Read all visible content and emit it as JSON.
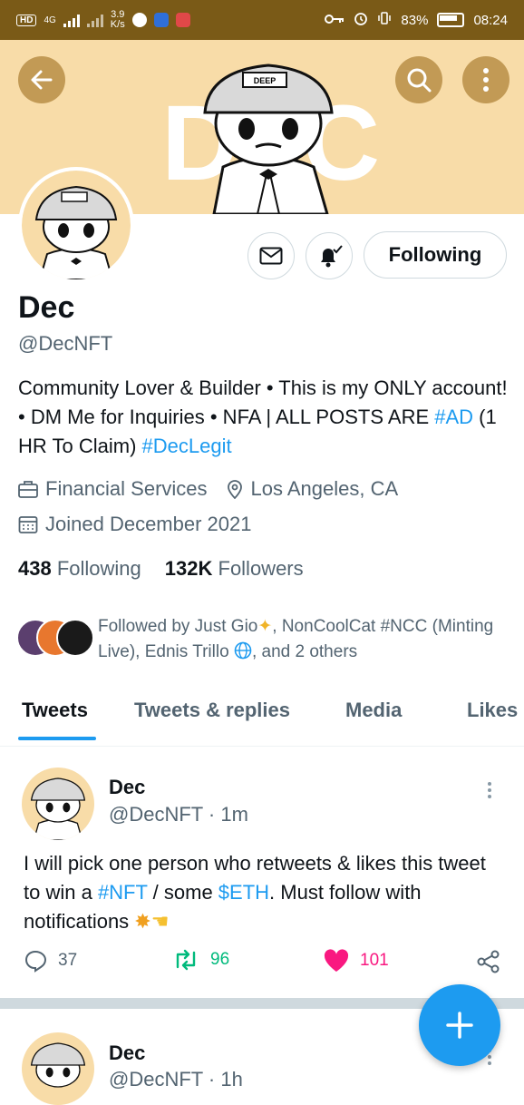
{
  "status_bar": {
    "hd": "HD",
    "network": "4G",
    "speed_value": "3.9",
    "speed_unit": "K/s",
    "battery": "83%",
    "time": "08:24"
  },
  "banner": {
    "text": "DEC",
    "cap_text": "DEEP",
    "color": "#f8dca8"
  },
  "profile": {
    "name": "Dec",
    "handle": "@DecNFT",
    "follow_button": "Following",
    "bio_parts": {
      "p1": "Community Lover & Builder • This is my ONLY account! • DM Me for Inquiries • NFA | ALL POSTS ARE ",
      "tag1": "#AD",
      "p2": " (1 HR To Claim) ",
      "tag2": "#DecLegit"
    },
    "category": "Financial Services",
    "location": "Los Angeles, CA",
    "joined": "Joined December 2021",
    "following_count": "438",
    "following_label": "Following",
    "followers_count": "132K",
    "followers_label": "Followers",
    "followed_by": {
      "prefix": "Followed by Just Gio",
      "middle": ", NonCoolCat #NCC (Minting Live), Ednis Trillo ",
      "suffix": ", and 2 others"
    }
  },
  "tabs": [
    "Tweets",
    "Tweets & replies",
    "Media",
    "Likes"
  ],
  "tweets": [
    {
      "name": "Dec",
      "handle_time": "@DecNFT · 1m",
      "text": {
        "p1": "I will pick one person who retweets & likes this tweet to win a ",
        "tag1": "#NFT",
        "p2": " / some ",
        "tag2": "$ETH",
        "p3": ". Must follow with notifications "
      },
      "replies": "37",
      "retweets": "96",
      "likes": "101"
    },
    {
      "name": "Dec",
      "handle_time": "@DecNFT · 1h"
    }
  ],
  "colors": {
    "accent": "#1d9bf0",
    "retweet": "#00ba7c",
    "like": "#f91880",
    "status_bar": "#7a5a17"
  },
  "icons": {
    "back": "arrow-left-icon",
    "search": "search-icon",
    "more": "more-vertical-icon",
    "message": "envelope-icon",
    "notifications": "bell-check-icon",
    "compose": "plus-icon"
  }
}
